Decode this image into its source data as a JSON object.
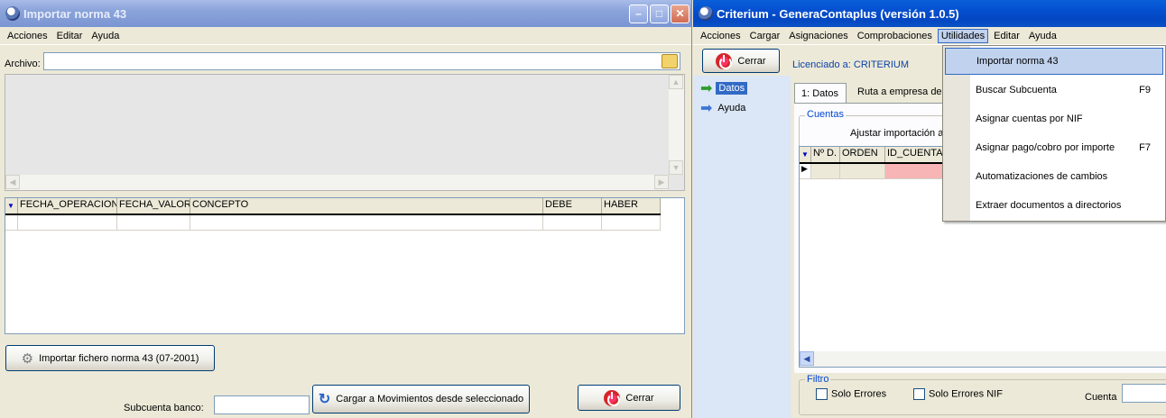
{
  "left_window": {
    "title": "Importar norma 43",
    "menu": [
      "Acciones",
      "Editar",
      "Ayuda"
    ],
    "archivo_label": "Archivo:",
    "archivo_value": "",
    "columns": [
      "FECHA_OPERACION",
      "FECHA_VALOR",
      "CONCEPTO",
      "DEBE",
      "HABER"
    ],
    "import_button": "Importar fichero norma 43 (07-2001)",
    "subcuenta_label": "Subcuenta banco:",
    "subcuenta_value": "",
    "load_button": "Cargar a Movimientos desde seleccionado",
    "close_button": "Cerrar"
  },
  "right_window": {
    "title": "Criterium - GeneraContaplus (versión 1.0.5)",
    "menu": [
      "Acciones",
      "Cargar",
      "Asignaciones",
      "Comprobaciones",
      "Utilidades",
      "Editar",
      "Ayuda"
    ],
    "close_button": "Cerrar",
    "license": "Licenciado a: CRITERIUM",
    "sidebar": [
      "Datos",
      "Ayuda"
    ],
    "tabs": [
      "1: Datos",
      "Ruta a empresa de C"
    ],
    "cuentas_group": "Cuentas",
    "ajustar_label": "Ajustar importación a",
    "columns": [
      "Nº D.",
      "ORDEN",
      "ID_CUENTA"
    ],
    "filtro_group": "Filtro",
    "solo_errores": "Solo Errores",
    "solo_errores_nif": "Solo Errores NIF",
    "cuenta_label": "Cuenta",
    "cuenta_value": ""
  },
  "utilidades_menu": [
    {
      "label": "Importar norma 43",
      "shortcut": ""
    },
    {
      "label": "Buscar Subcuenta",
      "shortcut": "F9"
    },
    {
      "label": "Asignar cuentas por NIF",
      "shortcut": ""
    },
    {
      "label": "Asignar pago/cobro por importe",
      "shortcut": "F7"
    },
    {
      "label": "Automatizaciones de cambios",
      "shortcut": ""
    },
    {
      "label": "Extraer documentos a directorios",
      "shortcut": ""
    }
  ],
  "colors": {
    "active_title": "#0553d3",
    "inactive_title": "#8aa3d9",
    "highlight": "#c1d2ee",
    "sidebar_bg": "#dbe6f7"
  }
}
